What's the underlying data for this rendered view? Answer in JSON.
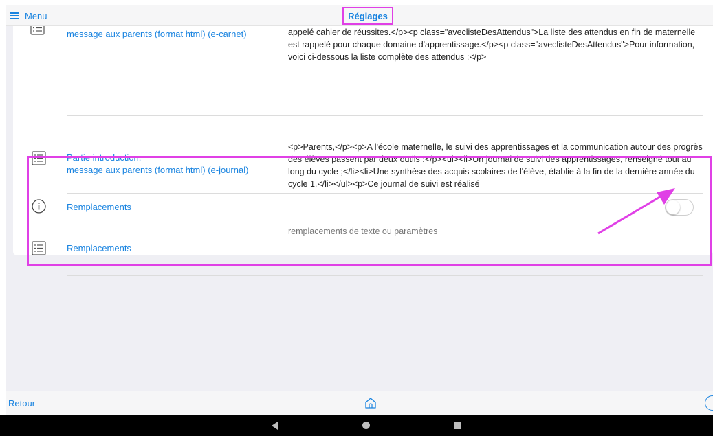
{
  "header": {
    "menu_label": "Menu",
    "title": "Réglages"
  },
  "rows": [
    {
      "label_line1": "",
      "label_line2": "message aux parents (format html) (e-carnet)",
      "value": "objectifs travaillés en voie d'acquisition ou atteints sont présentés. </p><p>Ceci explique pourquoi il est aussi appelé cahier de réussites.</p><p class=\"aveclisteDesAttendus\">La liste des attendus en fin de maternelle est rappelé pour chaque domaine d'apprentissage.</p><p class=\"aveclisteDesAttendus\">Pour information, voici ci-dessous la liste complète des attendus :</p>",
      "icon": "list-icon"
    },
    {
      "label_line1": "Partie introduction,",
      "label_line2": "message aux parents (format html) (e-journal)",
      "value": "<p>Parents,</p><p>A l'école maternelle, le suivi des apprentissages et la communication autour des progrès des élèves passent par deux outils :</p><ul><li>Un journal de suivi des apprentissages, renseigné tout au long du cycle ;</li><li>Une synthèse des acquis scolaires de l'élève, établie à la fin de la dernière année du cycle 1.</li></ul><p>Ce journal de suivi est réalisé",
      "icon": "list-icon"
    }
  ],
  "remplacements_toggle": {
    "label": "Remplacements",
    "icon": "info-icon",
    "state": "off"
  },
  "remplacements_list": {
    "label": "Remplacements",
    "value": "remplacements de texte ou paramètres",
    "icon": "list-icon"
  },
  "footer": {
    "back_label": "Retour",
    "home_icon": "home-icon"
  },
  "android_nav": {
    "back_icon": "triangle-back-icon",
    "home_icon": "circle-home-icon",
    "recents_icon": "square-recents-icon"
  },
  "colors": {
    "accent": "#1a84e0",
    "highlight": "#e040e6",
    "background": "#efeff4"
  }
}
